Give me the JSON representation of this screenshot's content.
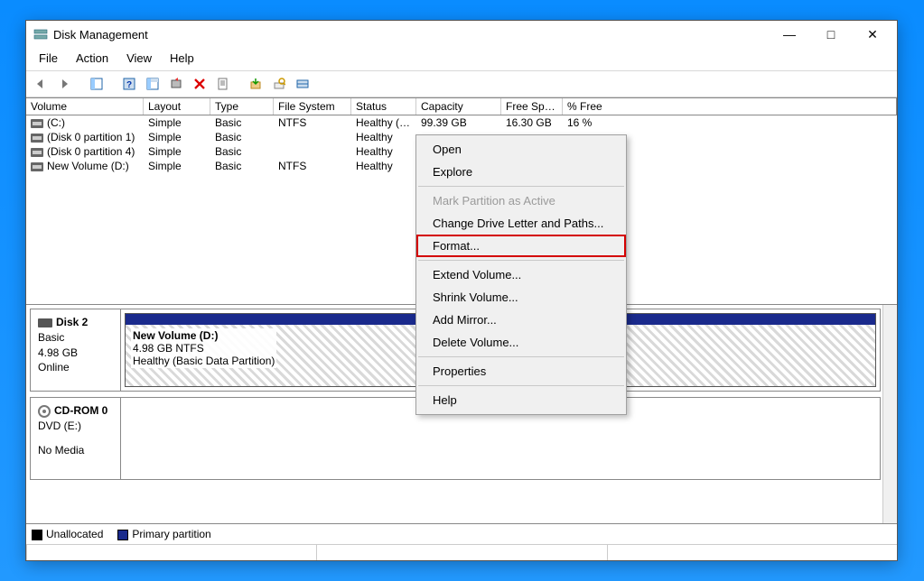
{
  "window": {
    "title": "Disk Management",
    "menus": [
      "File",
      "Action",
      "View",
      "Help"
    ],
    "winbtns": {
      "min": "—",
      "max": "□",
      "close": "✕"
    }
  },
  "columns": {
    "volume": "Volume",
    "layout": "Layout",
    "type": "Type",
    "fs": "File System",
    "status": "Status",
    "capacity": "Capacity",
    "free": "Free Spa...",
    "pfree": "% Free"
  },
  "volumes": [
    {
      "name": "(C:)",
      "layout": "Simple",
      "type": "Basic",
      "fs": "NTFS",
      "status": "Healthy (B...",
      "cap": "99.39 GB",
      "free": "16.30 GB",
      "pfree": "16 %"
    },
    {
      "name": "(Disk 0 partition 1)",
      "layout": "Simple",
      "type": "Basic",
      "fs": "",
      "status": "Healthy",
      "cap": "",
      "free": "",
      "pfree": ""
    },
    {
      "name": "(Disk 0 partition 4)",
      "layout": "Simple",
      "type": "Basic",
      "fs": "",
      "status": "Healthy",
      "cap": "",
      "free": "",
      "pfree": ""
    },
    {
      "name": "New Volume (D:)",
      "layout": "Simple",
      "type": "Basic",
      "fs": "NTFS",
      "status": "Healthy",
      "cap": "",
      "free": "",
      "pfree": ""
    }
  ],
  "disks": [
    {
      "icon": "disk",
      "name": "Disk 2",
      "type": "Basic",
      "size": "4.98 GB",
      "state": "Online",
      "parts": [
        {
          "title": "New Volume  (D:)",
          "sub1": "4.98 GB NTFS",
          "sub2": "Healthy (Basic Data Partition)",
          "width": "100%"
        }
      ]
    },
    {
      "icon": "cd",
      "name": "CD-ROM 0",
      "type": "DVD (E:)",
      "size": "",
      "state": "No Media",
      "parts": []
    }
  ],
  "legend": {
    "unalloc": "Unallocated",
    "primary": "Primary partition"
  },
  "context_menu": [
    {
      "label": "Open",
      "type": "item"
    },
    {
      "label": "Explore",
      "type": "item"
    },
    {
      "type": "sep"
    },
    {
      "label": "Mark Partition as Active",
      "type": "disabled"
    },
    {
      "label": "Change Drive Letter and Paths...",
      "type": "item"
    },
    {
      "label": "Format...",
      "type": "highlight"
    },
    {
      "type": "sep"
    },
    {
      "label": "Extend Volume...",
      "type": "item"
    },
    {
      "label": "Shrink Volume...",
      "type": "item"
    },
    {
      "label": "Add Mirror...",
      "type": "item"
    },
    {
      "label": "Delete Volume...",
      "type": "item"
    },
    {
      "type": "sep"
    },
    {
      "label": "Properties",
      "type": "item"
    },
    {
      "type": "sep"
    },
    {
      "label": "Help",
      "type": "item"
    }
  ]
}
